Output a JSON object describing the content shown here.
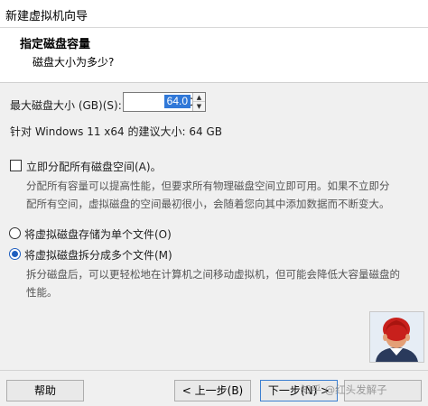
{
  "window": {
    "title": "新建虚拟机向导"
  },
  "header": {
    "heading": "指定磁盘容量",
    "subheading": "磁盘大小为多少?"
  },
  "disk_size": {
    "label": "最大磁盘大小 (GB)(S):",
    "value": "64.0",
    "recommendation": "针对 Windows 11 x64 的建议大小: 64 GB"
  },
  "allocate": {
    "label": "立即分配所有磁盘空间(A)。",
    "checked": false,
    "description_line1": "分配所有容量可以提高性能，但要求所有物理磁盘空间立即可用。如果不立即分",
    "description_line2": "配所有空间，虚拟磁盘的空间最初很小，会随着您向其中添加数据而不断变大。"
  },
  "storage_options": {
    "single_label": "将虚拟磁盘存储为单个文件(O)",
    "multi_label": "将虚拟磁盘拆分成多个文件(M)",
    "selected": "multi",
    "multi_description_line1": "拆分磁盘后，可以更轻松地在计算机之间移动虚拟机，但可能会降低大容量磁盘的",
    "multi_description_line2": "性能。"
  },
  "buttons": {
    "help": "帮助",
    "back": "< 上一步(B)",
    "next": "下一步(N) >"
  },
  "watermark": "知乎 @红头发解子",
  "colors": {
    "selection": "#3078d8",
    "radio_accent": "#1f5fbf",
    "window_bg": "#f0f0f0"
  },
  "icons": {
    "avatar": "red-haired-person-avatar"
  }
}
